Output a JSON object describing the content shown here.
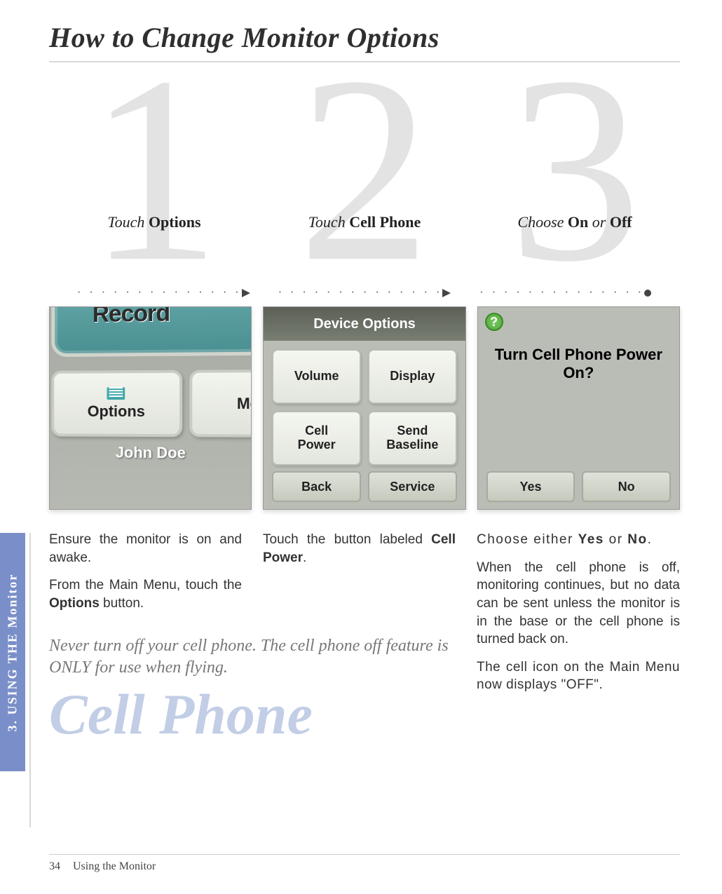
{
  "title": "How to Change Monitor Options",
  "side_tab": "3. USING THE Monitor",
  "steps": [
    {
      "num": "1",
      "caption_pre": "Touch ",
      "caption_b": "Options",
      "caption_post": ""
    },
    {
      "num": "2",
      "caption_pre": "Touch ",
      "caption_b": "Cell Phone",
      "caption_post": ""
    },
    {
      "num": "3",
      "caption_pre": "Choose ",
      "caption_b": "On",
      "caption_mid": " or ",
      "caption_b2": "Off"
    }
  ],
  "screenshot1": {
    "teal_label": "Record",
    "options_btn": "Options",
    "messages_btn": "Mess",
    "user_name": "John Doe"
  },
  "screenshot2": {
    "header": "Device Options",
    "cells": [
      "Volume",
      "Display",
      "Cell Power",
      "Send Baseline"
    ],
    "back": "Back",
    "service": "Service"
  },
  "screenshot3": {
    "help": "?",
    "question": "Turn Cell Phone Power On?",
    "yes": "Yes",
    "no": "No"
  },
  "body": {
    "c1p1": "Ensure the monitor is on and awake.",
    "c1p2_pre": "From the Main Menu, touch the ",
    "c1p2_b": "Options",
    "c1p2_post": " button.",
    "c2p1_pre": "Touch the button labeled ",
    "c2p1_b": "Cell Power",
    "c2p1_post": ".",
    "warning": "Never turn off your cell phone. The cell phone off feature is ONLY for use when flying.",
    "topic": "Cell Phone",
    "c3p1_pre": "Choose either ",
    "c3p1_b1": "Yes",
    "c3p1_mid": " or ",
    "c3p1_b2": "No",
    "c3p1_post": ".",
    "c3p2": "When the cell phone is off, monitoring continues, but no data can be sent unless the monitor is in the base or the cell phone is turned back on.",
    "c3p3": "The cell icon on the Main Menu now displays \"OFF\"."
  },
  "footer": {
    "page": "34",
    "section": "Using the Monitor"
  }
}
